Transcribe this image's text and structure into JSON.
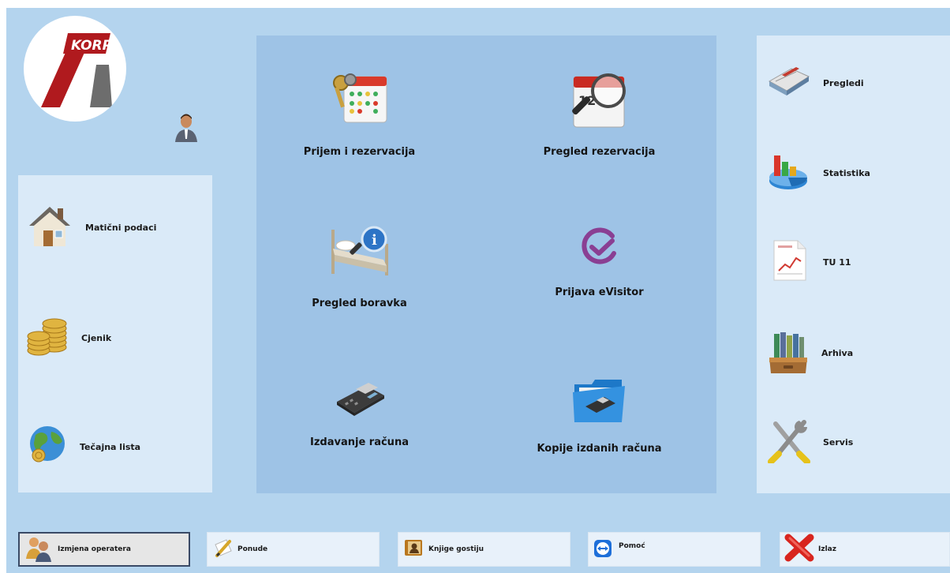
{
  "logo": {
    "text": "KORP",
    "brand_color": "#b01a1e"
  },
  "left_menu": {
    "items": [
      {
        "label": "Matični podaci",
        "icon": "house-icon"
      },
      {
        "label": "Cjenik",
        "icon": "coins-icon"
      },
      {
        "label": "Tečajna lista",
        "icon": "globe-coins-icon"
      }
    ]
  },
  "center_menu": {
    "tiles": [
      {
        "label": "Prijem i rezervacija",
        "icon": "calendar-keys-icon"
      },
      {
        "label": "Pregled rezervacija",
        "icon": "calendar-magnifier-icon"
      },
      {
        "label": "Pregled boravka",
        "icon": "bed-info-icon"
      },
      {
        "label": "Prijava eVisitor",
        "icon": "evisitor-logo-icon"
      },
      {
        "label": "Izdavanje računa",
        "icon": "card-terminal-icon"
      },
      {
        "label": "Kopije izdanih računa",
        "icon": "folder-terminal-icon"
      }
    ]
  },
  "right_menu": {
    "items": [
      {
        "label": "Pregledi",
        "icon": "books-icon"
      },
      {
        "label": "Statistika",
        "icon": "chart-icon"
      },
      {
        "label": "TU 11",
        "icon": "report-document-icon"
      },
      {
        "label": "Arhiva",
        "icon": "archive-box-icon"
      },
      {
        "label": "Servis",
        "icon": "tools-icon"
      }
    ]
  },
  "bottom_bar": {
    "buttons": [
      {
        "label": "Izmjena operatera",
        "icon": "operators-icon",
        "active": true
      },
      {
        "label": "Ponude",
        "icon": "pen-paper-icon"
      },
      {
        "label": "Knjige gostiju",
        "icon": "guest-book-icon"
      },
      {
        "label": "Pomoć",
        "icon": "teamviewer-icon"
      },
      {
        "label": "Izlaz",
        "icon": "red-x-icon"
      }
    ]
  },
  "colors": {
    "background": "#b4d4ee",
    "center_panel": "#9ec3e6",
    "side_panels": "#daeaf8",
    "evisitor_purple": "#8a3f93",
    "exit_red": "#d8251e"
  }
}
